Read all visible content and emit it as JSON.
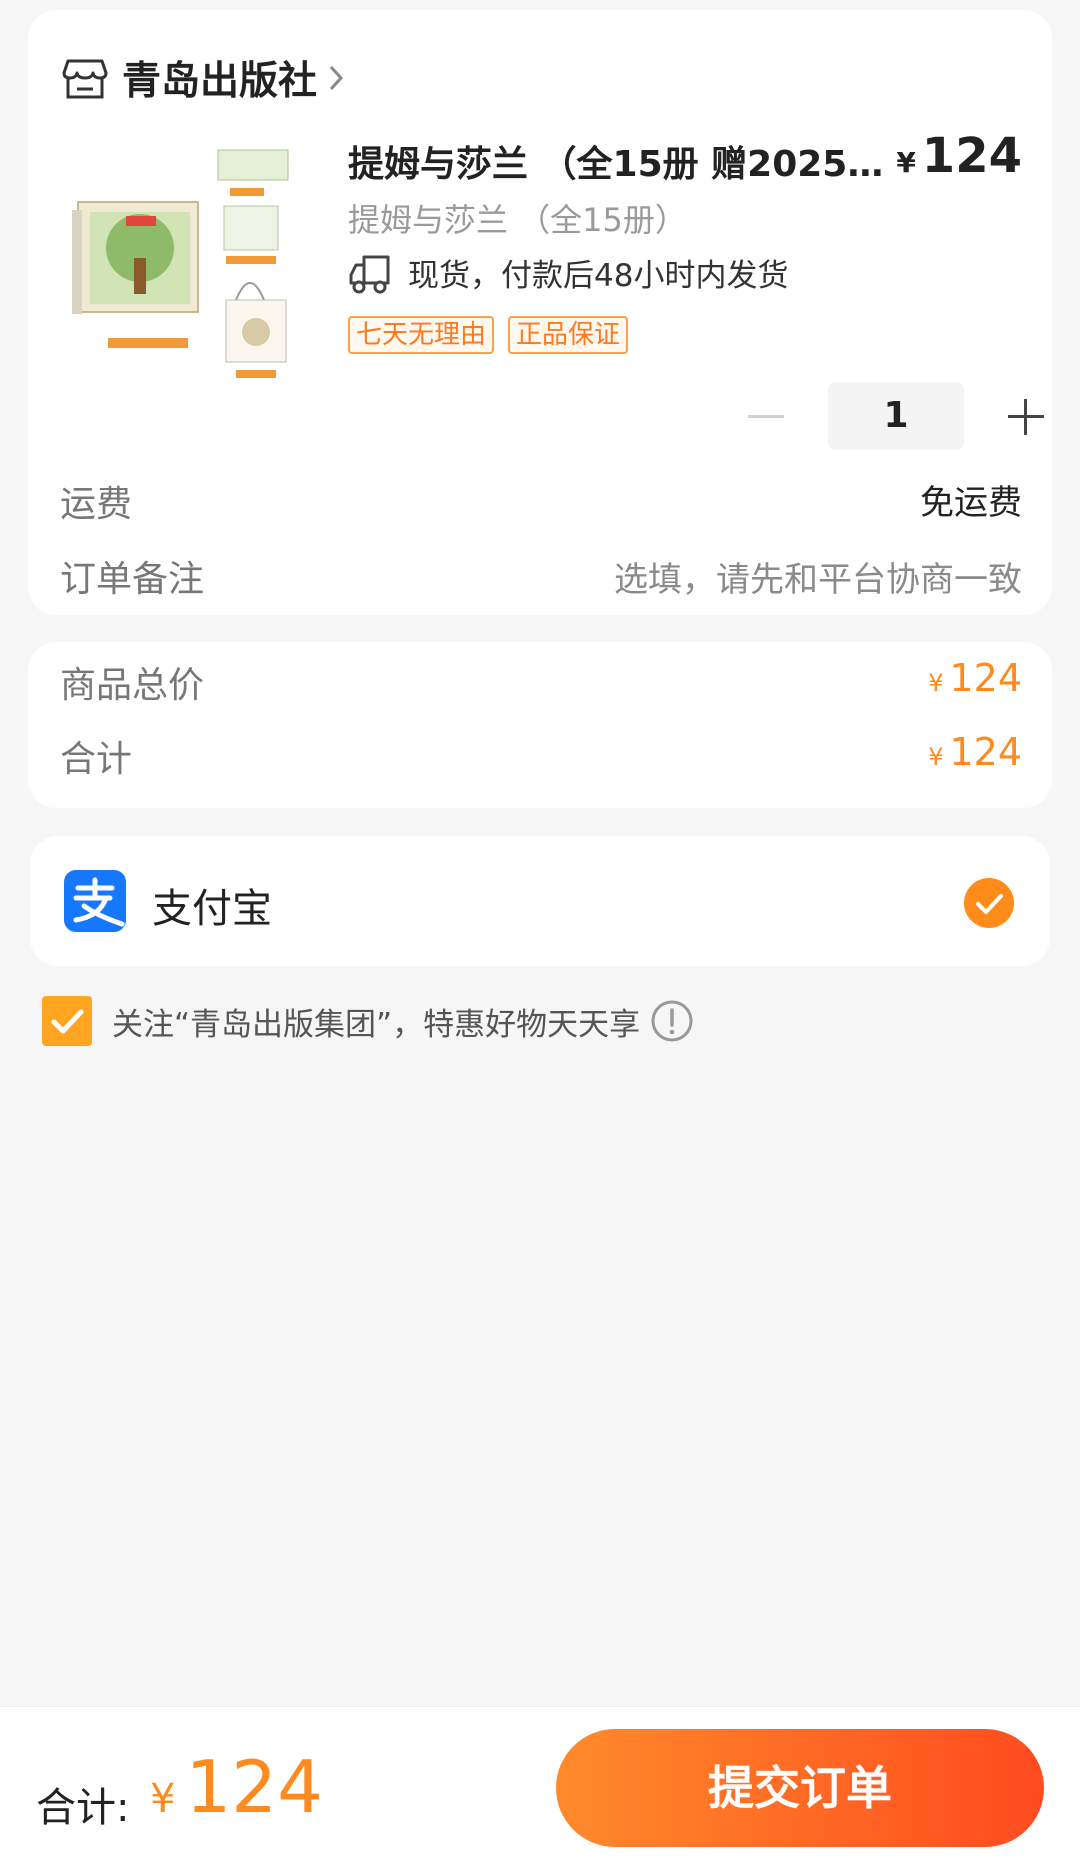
{
  "store": {
    "name": "青岛出版社"
  },
  "product": {
    "title": "提姆与莎兰 （全15册 赠2025…",
    "price_symbol": "¥",
    "price": "124",
    "subtitle": "提姆与莎兰 （全15册）",
    "shipping": "现货，付款后48小时内发货",
    "badges": [
      "七天无理由",
      "正品保证"
    ],
    "quantity": "1"
  },
  "order": {
    "shipping_label": "运费",
    "shipping_value": "免运费",
    "note_label": "订单备注",
    "note_placeholder": "选填，请先和平台协商一致"
  },
  "totals": {
    "goods_label": "商品总价",
    "goods_value": "124",
    "sum_label": "合计",
    "sum_value": "124",
    "symbol": "¥"
  },
  "payment": {
    "method": "支付宝",
    "selected": true
  },
  "follow": {
    "text": "关注“青岛出版集团”，特惠好物天天享",
    "checked": true
  },
  "footer": {
    "total_label": "合计:",
    "symbol": "¥",
    "total_value": "124",
    "submit_label": "提交订单"
  },
  "colors": {
    "accent": "#ff8a1f",
    "button_start": "#ff8a2b",
    "button_end": "#ff4b1f",
    "alipay": "#1677ff"
  }
}
